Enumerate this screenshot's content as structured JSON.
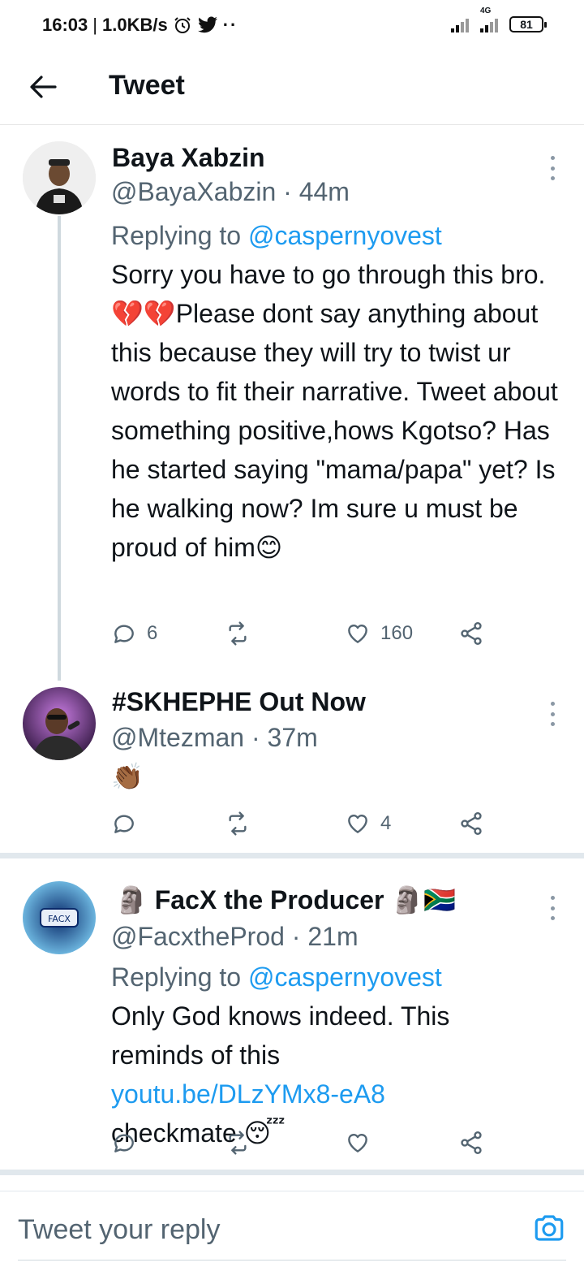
{
  "status_bar": {
    "time": "16:03",
    "speed": "1.0KB/s",
    "network_label": "4G",
    "battery": "81",
    "alarm_icon": "alarm-icon",
    "twitter_icon": "bird-icon"
  },
  "header": {
    "title": "Tweet",
    "back_icon": "arrow-left-icon"
  },
  "tweets": [
    {
      "name": "Baya Xabzin",
      "handle_time": "@BayaXabzin · 44m",
      "replying_prefix": "Replying to ",
      "replying_handle": "@caspernyovest",
      "body_1": "Sorry you have to go through this bro. ",
      "body_2": "Please dont say anything about this because they will try to twist ur words to fit their narrative. Tweet about something positive,hows Kgotso? Has he started saying \"mama/papa\" yet? Is he walking now? Im sure u must be proud of him",
      "emoji_broken_heart": "💔",
      "emoji_smile": "😊",
      "replies": "6",
      "retweets": "",
      "likes": "160"
    },
    {
      "name": "#SKHEPHE Out Now",
      "handle_time": "@Mtezman · 37m",
      "body": "👏🏾",
      "replies": "",
      "retweets": "",
      "likes": "4"
    },
    {
      "name_prefix_emoji": "🗿",
      "name": "FacX the Producer",
      "name_suffix_emoji": "🗿🇿🇦",
      "avatar_text": "FACX",
      "handle_time": "@FacxtheProd · 21m",
      "replying_prefix": "Replying to ",
      "replying_handle": "@caspernyovest",
      "body_1": "Only God knows indeed. This reminds of this ",
      "link": "youtu.be/DLzYMx8-eA8",
      "body_2": " checkmate ",
      "emoji_sleep": "😴",
      "replies": "",
      "retweets": "",
      "likes": ""
    }
  ],
  "reply_bar": {
    "placeholder": "Tweet your reply",
    "camera_icon": "camera-icon"
  },
  "colors": {
    "accent": "#1d9bf0",
    "muted": "#536471",
    "divider": "#e1e8ed"
  }
}
